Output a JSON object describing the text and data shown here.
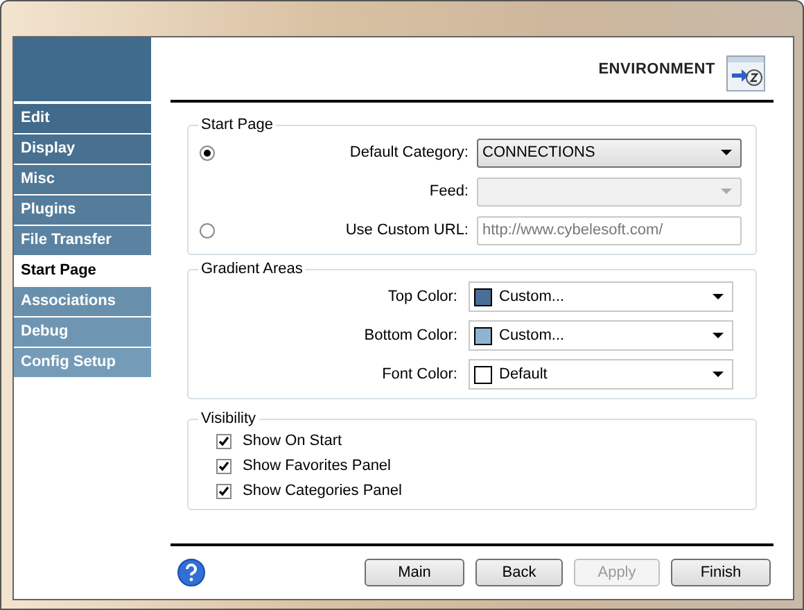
{
  "window": {
    "header": "ENVIRONMENT"
  },
  "sidebar": {
    "items": [
      {
        "label": "Edit",
        "selected": false
      },
      {
        "label": "Display",
        "selected": false
      },
      {
        "label": "Misc",
        "selected": false
      },
      {
        "label": "Plugins",
        "selected": false
      },
      {
        "label": "File Transfer",
        "selected": false
      },
      {
        "label": "Start Page",
        "selected": true
      },
      {
        "label": "Associations",
        "selected": false
      },
      {
        "label": "Debug",
        "selected": false
      },
      {
        "label": "Config Setup",
        "selected": false
      }
    ]
  },
  "start_page": {
    "title": "Start Page",
    "rows": [
      {
        "kind": "combo",
        "label": "Default Category:",
        "value": "CONNECTIONS",
        "selected": true,
        "disabled": false
      },
      {
        "kind": "combo",
        "label": "Feed:",
        "disabled": true
      },
      {
        "kind": "text",
        "label": "Use Custom URL:",
        "value": "http://www.cybelesoft.com/",
        "selected": false,
        "disabled": true
      }
    ]
  },
  "gradient_areas": {
    "title": "Gradient Areas",
    "rows": [
      {
        "label": "Top Color:",
        "value": "Custom...",
        "color": "#4a6e95"
      },
      {
        "label": "Bottom Color:",
        "value": "Custom...",
        "color": "#8fb4d0"
      },
      {
        "label": "Font Color:",
        "value": "Default",
        "color": "#ffffff"
      }
    ]
  },
  "visibility": {
    "title": "Visibility",
    "options": [
      {
        "label": "Show On Start",
        "checked": true
      },
      {
        "label": "Show Favorites Panel",
        "checked": true
      },
      {
        "label": "Show Categories Panel",
        "checked": true
      }
    ]
  },
  "buttons": [
    {
      "label": "Main",
      "disabled": false
    },
    {
      "label": "Back",
      "disabled": false
    },
    {
      "label": "Apply",
      "disabled": true
    },
    {
      "label": "Finish",
      "disabled": false
    }
  ]
}
